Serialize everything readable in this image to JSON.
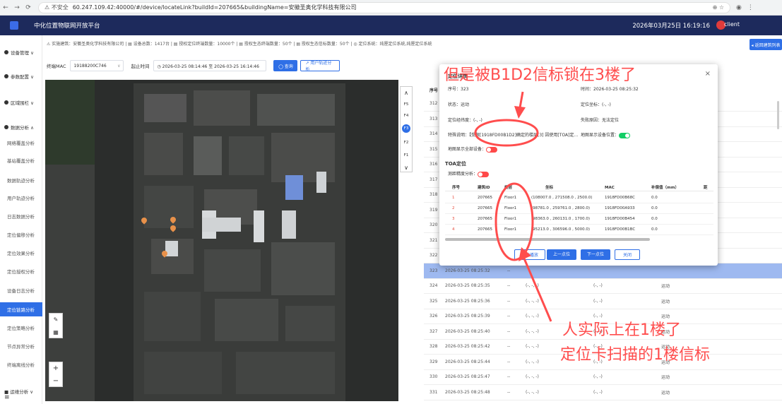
{
  "browser": {
    "warning": "⚠ 不安全",
    "url": "60.247.109.42:40000/#/device/locateLink?buildId=207665&buildingName=安徽圣奥化学科技有限公司"
  },
  "header": {
    "title": "中化位置物联网开放平台",
    "datetime": "2026年03月25日  16:19:16",
    "user": "client"
  },
  "sidebar": {
    "items": [
      {
        "label": "设备管理 ∨"
      },
      {
        "label": "参数配置 ∨"
      },
      {
        "label": "区域围栏 ∨"
      },
      {
        "label": "数据分析 ∧"
      },
      {
        "label": "网络覆盖分析"
      },
      {
        "label": "基站覆盖分析"
      },
      {
        "label": "数据轨迹分析"
      },
      {
        "label": "用户轨迹分析"
      },
      {
        "label": "日志数据分析"
      },
      {
        "label": "定位偏移分析"
      },
      {
        "label": "定位效果分析"
      },
      {
        "label": "定位授权分析"
      },
      {
        "label": "设备日志分析"
      },
      {
        "label": "定位链路分析"
      },
      {
        "label": "定位策略分析"
      },
      {
        "label": "节点异常分析"
      },
      {
        "label": "终端离线分析"
      },
      {
        "label": "■ 运维分析 ∨"
      }
    ]
  },
  "info_strip": "⚠ 实施建筑：安徽圣奥化学科技有限公司 | ▤ 设备总数：1417台 | ▤ 授权定位终端数量：10000个 | ▤ 授权生态终端数量：50个 | ▤ 授权生态信标数量：50个 | ◎ 定位系统：纯厘定位系统,纯厘定位系统",
  "back_button": "◂ 返回建筑列表",
  "filter": {
    "mac_label": "终端MAC",
    "mac_value": "19188200C746",
    "time_label": "起止时间",
    "time_value": "◷ 2026-03-25 08:14:46  至  2026-03-25 16:14:46",
    "query_button": "◯ 查询",
    "track_button": "↗ 用户轨迹分析"
  },
  "floors": [
    "F5",
    "F4",
    "F3",
    "F2",
    "F1"
  ],
  "active_floor": "F3",
  "table": {
    "header_num": "序号",
    "rows": [
      {
        "num": "312",
        "time": "",
        "dash": "",
        "coord": "",
        "coord2": "",
        "status": ""
      },
      {
        "num": "313",
        "time": "",
        "dash": "",
        "coord": "",
        "coord2": "",
        "status": ""
      },
      {
        "num": "314",
        "time": "",
        "dash": "",
        "coord": "",
        "coord2": "",
        "status": ""
      },
      {
        "num": "315",
        "time": "",
        "dash": "",
        "coord": "",
        "coord2": "",
        "status": ""
      },
      {
        "num": "316",
        "time": "",
        "dash": "",
        "coord": "",
        "coord2": "",
        "status": ""
      },
      {
        "num": "317",
        "time": "",
        "dash": "",
        "coord": "",
        "coord2": "",
        "status": ""
      },
      {
        "num": "318",
        "time": "",
        "dash": "",
        "coord": "",
        "coord2": "",
        "status": ""
      },
      {
        "num": "319",
        "time": "",
        "dash": "",
        "coord": "",
        "coord2": "",
        "status": ""
      },
      {
        "num": "320",
        "time": "",
        "dash": "",
        "coord": "",
        "coord2": "",
        "status": ""
      },
      {
        "num": "321",
        "time": "",
        "dash": "",
        "coord": "",
        "coord2": "",
        "status": ""
      },
      {
        "num": "322",
        "time": "",
        "dash": "",
        "coord": "",
        "coord2": "",
        "status": ""
      },
      {
        "num": "323",
        "time": "2026-03-25 08:25:32",
        "dash": "--",
        "coord": "",
        "coord2": "",
        "status": ""
      },
      {
        "num": "324",
        "time": "2026-03-25 08:25:35",
        "dash": "--",
        "coord": "(-, -, -)",
        "coord2": "(-, -)",
        "status": "运动"
      },
      {
        "num": "325",
        "time": "2026-03-25 08:25:36",
        "dash": "--",
        "coord": "(-, -, -)",
        "coord2": "(-, -)",
        "status": "运动"
      },
      {
        "num": "326",
        "time": "2026-03-25 08:25:39",
        "dash": "--",
        "coord": "(-, -, -)",
        "coord2": "(-, -)",
        "status": "运动"
      },
      {
        "num": "327",
        "time": "2026-03-25 08:25:40",
        "dash": "--",
        "coord": "(-, -, -)",
        "coord2": "(-, -)",
        "status": "运动"
      },
      {
        "num": "328",
        "time": "2026-03-25 08:25:42",
        "dash": "--",
        "coord": "(-, -, -)",
        "coord2": "(-, -)",
        "status": "运动"
      },
      {
        "num": "329",
        "time": "2026-03-25 08:25:44",
        "dash": "--",
        "coord": "(-, -, -)",
        "coord2": "(-, -)",
        "status": "运动"
      },
      {
        "num": "330",
        "time": "2026-03-25 08:25:47",
        "dash": "--",
        "coord": "(-, -, -)",
        "coord2": "(-, -)",
        "status": "运动"
      },
      {
        "num": "331",
        "time": "2026-03-25 08:25:48",
        "dash": "--",
        "coord": "(-, -, -)",
        "coord2": "(-, -)",
        "status": "运动"
      }
    ]
  },
  "dialog": {
    "title": "定位详情",
    "seq": "序号：323",
    "time": "时间：2026-03-25 08:25:32",
    "state": "状态：运动",
    "coord": "定位坐标：(-, -)",
    "lnglat": "定位经纬度：(-, -)",
    "fail_reason": "失败原因：无法定位",
    "special": "特殊说明：【受限[1918FD00B1D2]确定的楼层[3] 因使用[TOA]定...",
    "show_device_pos": "地图显示设备位置：",
    "show_all_devices": "地图显示全部设备：",
    "toa_title": "TOA定位",
    "ranging_analysis": "测距精度分析：",
    "subtable_headers": [
      "序号",
      "建筑ID",
      "楼层",
      "坐标",
      "MAC",
      "补偿值（mm）",
      "距"
    ],
    "subtable_rows": [
      [
        "1",
        "207665",
        "Floor1",
        "(108007.0 , 271508.0 , 2500.0)",
        "1918FD00B68C",
        "0.0"
      ],
      [
        "2",
        "207665",
        "Floor1",
        "(98781.0 , 259761.0 , 2800.0)",
        "1918FD00A933",
        "0.0"
      ],
      [
        "3",
        "207665",
        "Floor1",
        "(98363.0 , 260131.0 , 1700.0)",
        "1918FD00B454",
        "0.0"
      ],
      [
        "4",
        "207665",
        "Floor1",
        "(95213.0 , 306596.0 , 5000.0)",
        "1918FD00B1BC",
        "0.0"
      ]
    ],
    "auto_play": "自动播放",
    "prev": "上一点位",
    "next": "下一点位",
    "close": "关闭"
  },
  "annotations": {
    "top": "但是被B1D2信标锁在3楼了",
    "bottom1": "人实际上在1楼了",
    "bottom2": "定位卡扫描的1楼信标",
    "color": "#ff4d4d"
  }
}
